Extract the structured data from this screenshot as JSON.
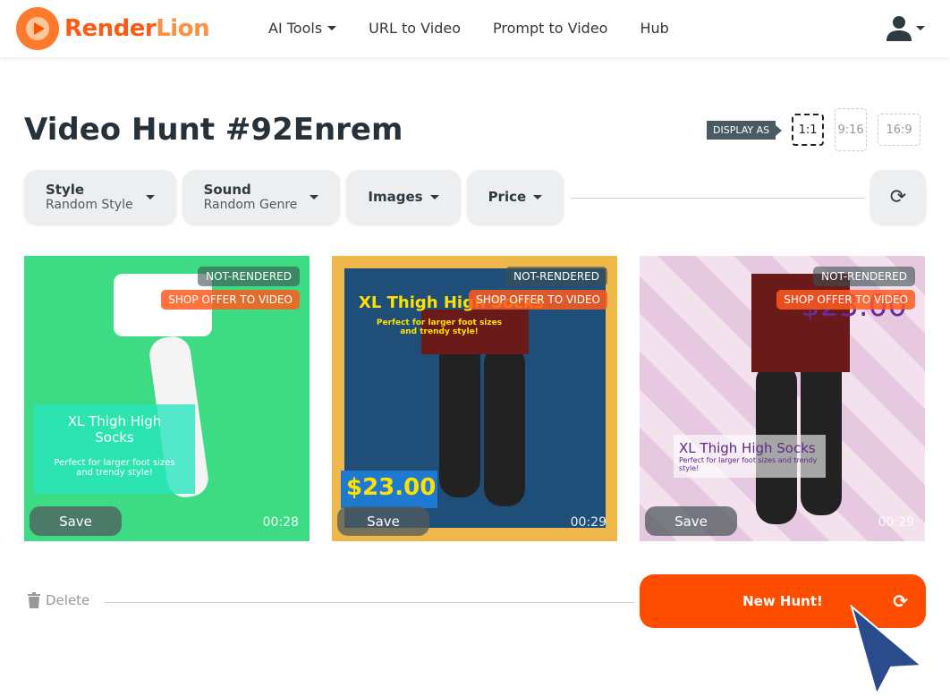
{
  "brand": {
    "part1": "Render",
    "part2": "Lion"
  },
  "nav": {
    "items": [
      {
        "label": "AI Tools"
      },
      {
        "label": "URL to Video"
      },
      {
        "label": "Prompt to Video"
      },
      {
        "label": "Hub"
      }
    ]
  },
  "page": {
    "title": "Video Hunt #92Enrem"
  },
  "display": {
    "label": "DISPLAY AS",
    "options": [
      "1:1",
      "9:16",
      "16:9"
    ],
    "selected": "1:1"
  },
  "filters": [
    {
      "label": "Style",
      "value": "Random Style"
    },
    {
      "label": "Sound",
      "value": "Random Genre"
    },
    {
      "label": "Images"
    },
    {
      "label": "Price"
    }
  ],
  "cards": [
    {
      "status": "NOT-RENDERED",
      "offer": "SHOP OFFER TO VIDEO",
      "save": "Save",
      "duration": "00:28",
      "title": "XL Thigh High Socks",
      "subtitle": "Perfect for larger foot sizes and trendy style!",
      "bg": "#3ddc84"
    },
    {
      "status": "NOT-RENDERED",
      "offer": "SHOP OFFER TO VIDEO",
      "save": "Save",
      "duration": "00:29",
      "title": "XL Thigh High Socks",
      "subtitle": "Perfect for larger foot sizes and trendy style!",
      "price": "$23.00",
      "bg": "#1f4f78"
    },
    {
      "status": "NOT-RENDERED",
      "offer": "SHOP OFFER TO VIDEO",
      "save": "Save",
      "duration": "00:29",
      "title": "XL Thigh High Socks",
      "subtitle": "Perfect for larger foot sizes and trendy style!",
      "price": "$23.00",
      "bg": "#ecd0e6"
    }
  ],
  "footer": {
    "delete": "Delete",
    "new_hunt": "New Hunt!"
  },
  "colors": {
    "accent": "#ff4d00"
  }
}
